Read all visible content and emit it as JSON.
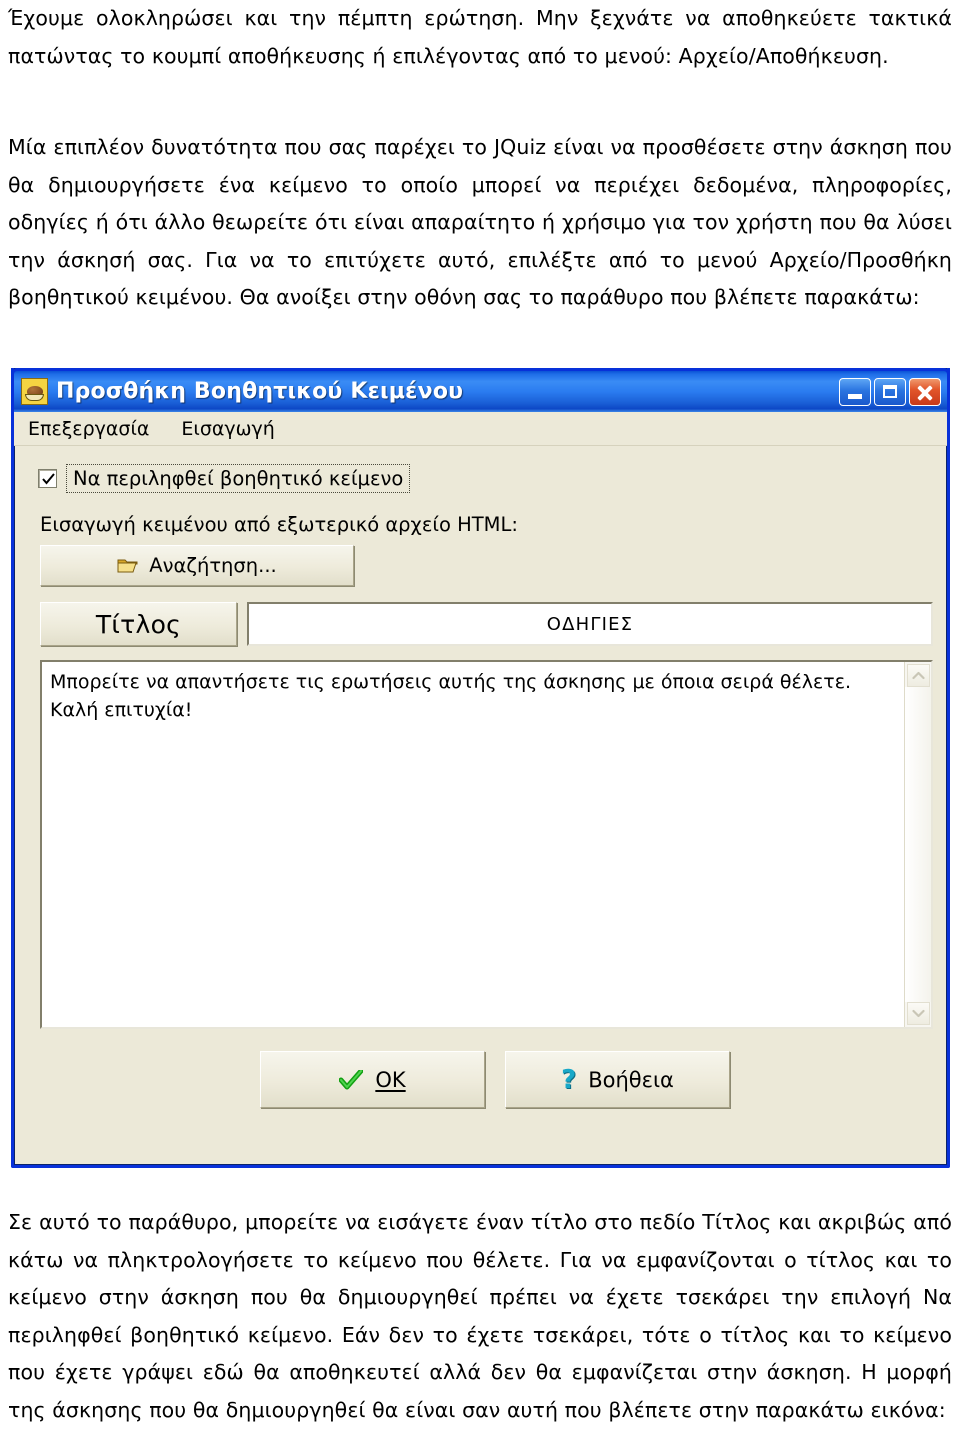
{
  "document": {
    "paragraph_top": "Έχουμε ολοκληρώσει και την πέμπτη ερώτηση. Μην ξεχνάτε να αποθηκεύετε τακτικά πατώντας το κουμπί αποθήκευσης ή επιλέγοντας από το μενού: Αρχείο/Αποθήκευση.",
    "paragraph_intro": "Μία επιπλέον δυνατότητα που σας παρέχει το JQuiz είναι να προσθέσετε στην άσκηση που θα δημιουργήσετε ένα κείμενο το οποίο μπορεί να περιέχει δεδομένα, πληροφορίες, οδηγίες ή ότι άλλο θεωρείτε ότι είναι απαραίτητο ή χρήσιμο για τον χρήστη που θα λύσει την άσκησή σας. Για να το επιτύχετε αυτό, επιλέξτε από το μενού Αρχείο/Προσθήκη βοηθητικού κειμένου. Θα ανοίξει στην οθόνη σας το παράθυρο που βλέπετε παρακάτω:",
    "paragraph_bottom": "Σε αυτό το παράθυρο, μπορείτε να εισάγετε έναν τίτλο στο πεδίο Τίτλος και ακριβώς από κάτω να πληκτρολογήσετε το κείμενο που θέλετε. Για να εμφανίζονται ο τίτλος και το κείμενο στην άσκηση που θα δημιουργηθεί πρέπει να έχετε τσεκάρει την επιλογή Να περιληφθεί βοηθητικό κείμενο. Εάν δεν το έχετε τσεκάρει, τότε ο τίτλος και το κείμενο που έχετε γράψει εδώ θα αποθηκευτεί αλλά δεν θα εμφανίζεται στην άσκηση. Η μορφή της άσκησης που θα δημιουργηθεί θα είναι σαν αυτή που βλέπετε στην παρακάτω εικόνα:"
  },
  "dialog": {
    "title": "Προσθήκη Βοηθητικού Κειμένου",
    "icon": "bread-roll-icon",
    "window_controls": {
      "minimize": "minimize-icon",
      "maximize": "maximize-icon",
      "close": "close-icon"
    },
    "menu": [
      {
        "label": "Επεξεργασία"
      },
      {
        "label": "Εισαγωγή"
      }
    ],
    "include_checkbox": {
      "label": "Να περιληφθεί βοηθητικό κείμενο",
      "checked": true
    },
    "import_label": "Εισαγωγή κειμένου από εξωτερικό αρχείο HTML:",
    "browse_button": {
      "label": "Αναζήτηση...",
      "icon": "open-folder-icon"
    },
    "title_field": {
      "button_label": "Τίτλος",
      "value": "ΟΔΗΓΙΕΣ"
    },
    "text_area": {
      "line1": "Μπορείτε να απαντήσετε τις ερωτήσεις αυτής της άσκησης με όποια σειρά θέλετε.",
      "line2": "Καλή επιτυχία!"
    },
    "scrollbar": {
      "up_arrow": "chevron-up-icon",
      "down_arrow": "chevron-down-icon"
    },
    "buttons": {
      "ok": {
        "label": "OK",
        "icon": "green-check-icon"
      },
      "help": {
        "label": "Βοήθεια",
        "icon": "question-mark-icon"
      }
    }
  },
  "colors": {
    "titlebar_blue": "#0831d9",
    "window_face": "#ece9d8",
    "close_red": "#e2562a",
    "check_green": "#00a000",
    "help_cyan": "#18a8c8"
  }
}
